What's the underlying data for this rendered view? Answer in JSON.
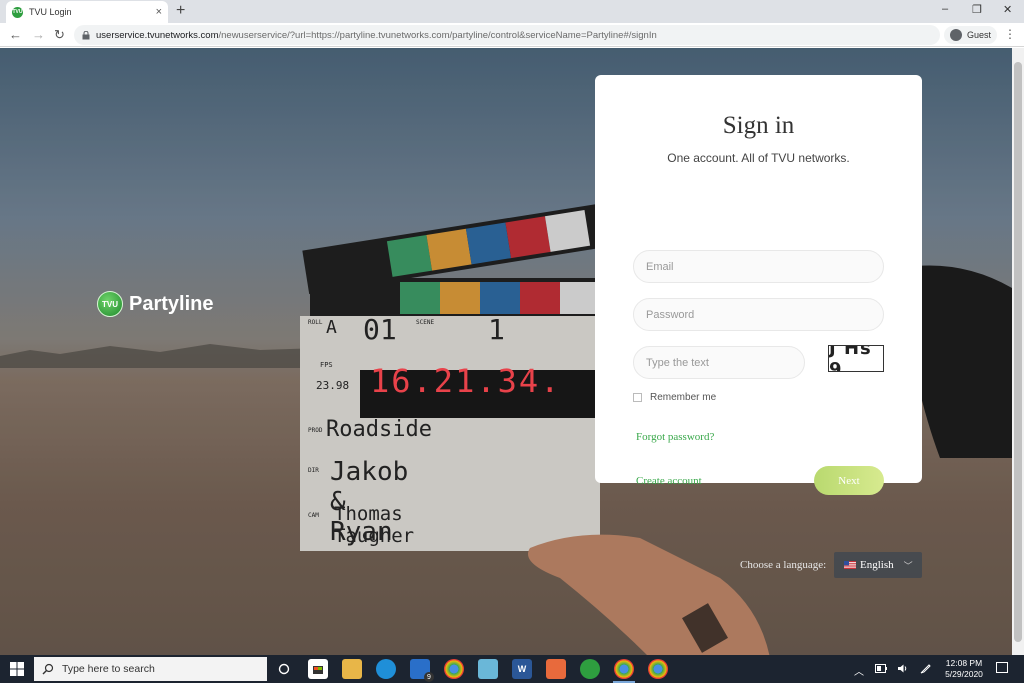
{
  "browser": {
    "tab_title": "TVU Login",
    "tab_favicon_text": "TVU",
    "close_tab": "×",
    "new_tab": "+",
    "window_controls": {
      "minimize": "–",
      "restore": "❐",
      "close": "✕"
    },
    "nav": {
      "back": "←",
      "forward": "→",
      "reload": "↻"
    },
    "url_host": "userservice.tvunetworks.com",
    "url_path": "/newuserservice/?url=https://partyline.tvunetworks.com/partyline/control&serviceName=Partyline#/signIn",
    "profile_label": "Guest",
    "menu": "⋮"
  },
  "brand": {
    "logo_text": "TVU",
    "name": "Partyline"
  },
  "clapper": {
    "roll": "A",
    "scene": "01",
    "take": "1",
    "fps": "23.98",
    "timecode": "16.21.34.",
    "prod": "Roadside",
    "dir": "Jakob & Ryan",
    "cam": "Thomas Taugher",
    "labels": {
      "roll": "ROLL",
      "scene": "SCENE",
      "fps": "FPS",
      "prod": "PROD",
      "dir": "DIR",
      "cam": "CAM"
    }
  },
  "signin": {
    "title": "Sign in",
    "subtitle": "One account. All of TVU networks.",
    "email_placeholder": "Email",
    "password_placeholder": "Password",
    "captcha_placeholder": "Type the text",
    "captcha_text": "J Hs 9",
    "remember_label": "Remember me",
    "forgot_label": "Forgot password?",
    "create_label": "Create account",
    "next_label": "Next"
  },
  "language": {
    "label": "Choose a language:",
    "selected": "English",
    "chevron": "﹀"
  },
  "taskbar": {
    "search_placeholder": "Type here to search",
    "mail_badge": "9",
    "tray_up": "︿",
    "clock_time": "12:08 PM",
    "clock_date": "5/29/2020"
  },
  "colors": {
    "accent_green": "#39a84a",
    "next_button": "#c8e27f",
    "taskbar": "#1c2430"
  }
}
